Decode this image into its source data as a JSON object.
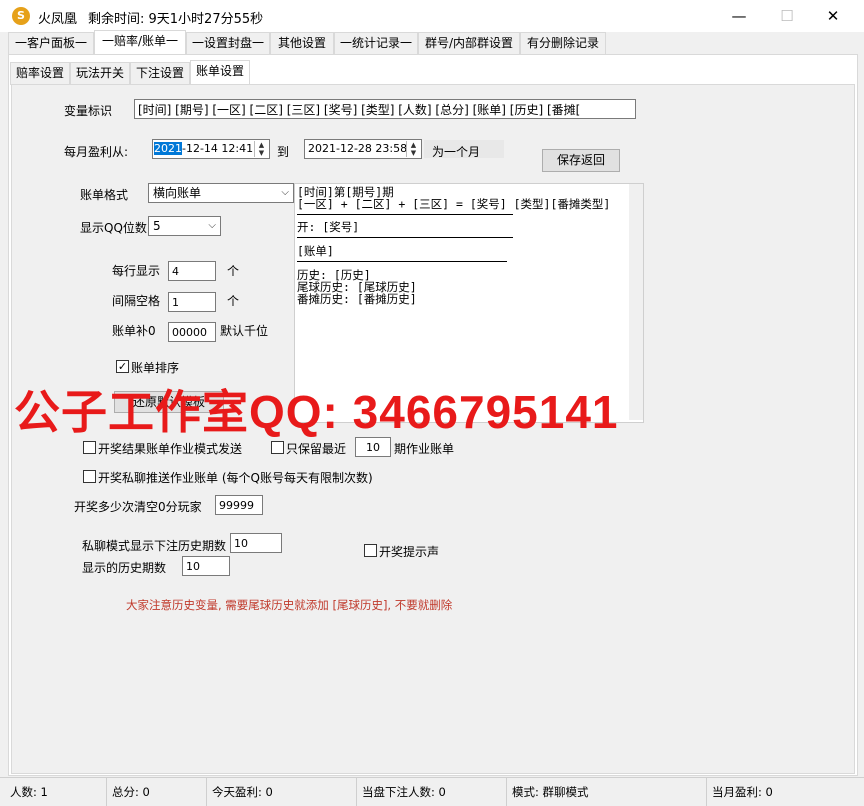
{
  "window": {
    "app_title": "火凤凰",
    "remaining_time": "剩余时间: 9天1小时27分55秒",
    "minimize": "—",
    "maximize": "☐",
    "close": "✕"
  },
  "main_tabs": [
    {
      "label": "一客户面板一"
    },
    {
      "label": "一赔率/账单一"
    },
    {
      "label": "一设置封盘一"
    },
    {
      "label": "其他设置"
    },
    {
      "label": "一统计记录一"
    },
    {
      "label": "群号/内部群设置"
    },
    {
      "label": "有分删除记录"
    }
  ],
  "sub_tabs": [
    {
      "label": "赔率设置"
    },
    {
      "label": "玩法开关"
    },
    {
      "label": "下注设置"
    },
    {
      "label": "账单设置"
    }
  ],
  "variables": {
    "label": "变量标识",
    "value": "[时间] [期号] [一区] [二区] [三区] [奖号] [类型] [人数] [总分] [账单] [历史] [番摊[",
    "monthly_label": "每月盈利从:",
    "start_date_sel": "2021",
    "start_date_rest": "-12-14 12:41",
    "to_label": "到",
    "end_date": "2021-12-28 23:58",
    "suffix": "为一个月",
    "save_button": "保存返回"
  },
  "bill": {
    "format_label": "账单格式",
    "format_value": "横向账单",
    "qq_digits_label": "显示QQ位数",
    "qq_digits_value": "5",
    "per_line_label": "每行显示",
    "per_line_value": "4",
    "per_line_unit": "个",
    "spacing_label": "间隔空格",
    "spacing_value": "1",
    "spacing_unit": "个",
    "pad_label": "账单补0",
    "pad_value": "00000",
    "pad_unit": "默认千位",
    "sort_label": "账单排序",
    "restore_button": "还原默认模板"
  },
  "preview": {
    "line1": "[时间]第[期号]期",
    "line2": "[一区] + [二区] + [三区] = [奖号] [类型][番摊类型]",
    "line3": "开: [奖号]",
    "line4": "[账单]",
    "line5": "历史: [历史]",
    "line6": "尾球历史: [尾球历史]",
    "line7": "番摊历史: [番摊历史]"
  },
  "watermark": "公子工作室QQ: 3466795141",
  "options": {
    "send_result_label": "开奖结果账单作业模式发送",
    "keep_recent_label": "只保留最近",
    "keep_recent_value": "10",
    "keep_recent_suffix": "期作业账单",
    "private_push_label": "开奖私聊推送作业账单 (每个Q账号每天有限制次数)",
    "clear_zero_label": "开奖多少次清空0分玩家",
    "clear_zero_value": "99999",
    "private_history_label": "私聊模式显示下注历史期数",
    "private_history_value": "10",
    "history_count_label": "显示的历史期数",
    "history_count_value": "10",
    "sound_label": "开奖提示声",
    "notice": "大家注意历史变量, 需要尾球历史就添加 [尾球历史], 不要就删除"
  },
  "status": {
    "players": "人数: 1",
    "total": "总分: 0",
    "today_profit": "今天盈利: 0",
    "current_bettors": "当盘下注人数: 0",
    "mode": "模式: 群聊模式",
    "month_profit": "当月盈利: 0"
  },
  "colors": {
    "accent_red": "#e81a1a",
    "notice_red": "#c0392b",
    "selection": "#0078d7"
  }
}
